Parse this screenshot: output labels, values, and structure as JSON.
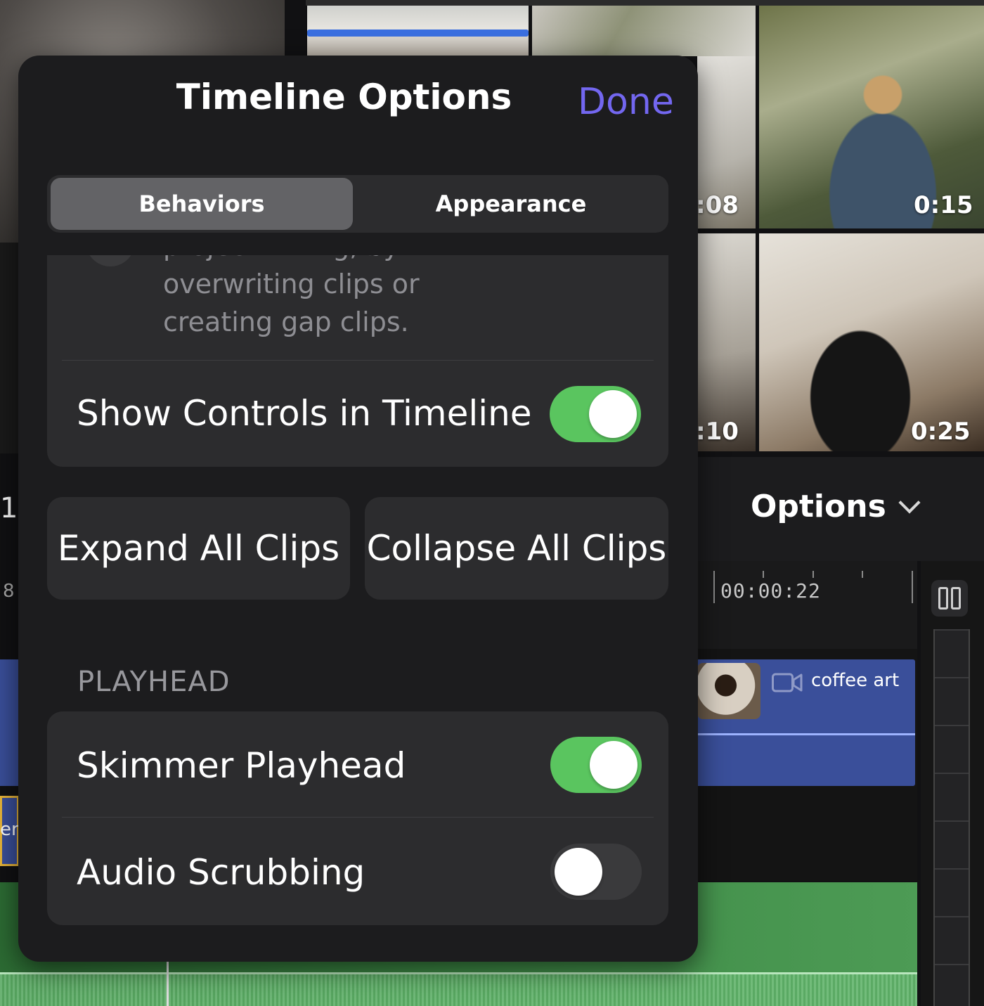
{
  "background": {
    "browser_durations": [
      ":08",
      "0:15",
      ":10",
      "0:25"
    ],
    "options_label": "Options",
    "left_edge_text": "1",
    "left_ruler_number": "8",
    "ruler_time": "00:00:22",
    "clip_label": "coffee art",
    "left_clip_text": "ere"
  },
  "popover": {
    "title": "Timeline Options",
    "done_label": "Done",
    "tabs": [
      {
        "label": "Behaviors",
        "selected": true
      },
      {
        "label": "Appearance",
        "selected": false
      }
    ],
    "description_lines": [
      "project timing, by",
      "overwriting clips or",
      "creating gap clips."
    ],
    "show_controls": {
      "label": "Show Controls in Timeline",
      "on": true
    },
    "buttons": {
      "expand": "Expand All Clips",
      "collapse": "Collapse All Clips"
    },
    "playhead_section": {
      "header": "PLAYHEAD",
      "rows": [
        {
          "label": "Skimmer Playhead",
          "on": true
        },
        {
          "label": "Audio Scrubbing",
          "on": false
        }
      ]
    }
  },
  "colors": {
    "accent": "#7367f0",
    "toggle_on": "#5ac55f",
    "toggle_off": "#3a3a3c",
    "clip_blue": "#3a4f9a",
    "audio_green": "#3d8a45"
  }
}
